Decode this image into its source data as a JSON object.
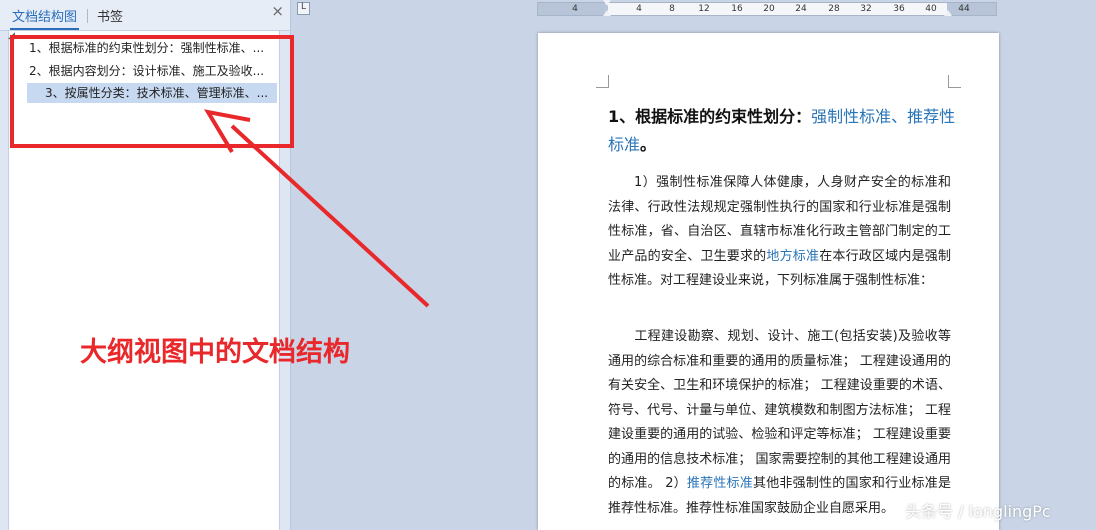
{
  "nav": {
    "tabs": [
      {
        "label": "文档结构图"
      },
      {
        "label": "书签"
      }
    ],
    "close_glyph": "×",
    "tree": [
      {
        "label": "1、根据标准的约束性划分：强制性标准、..."
      },
      {
        "label": "2、根据内容划分：设计标准、施工及验收..."
      },
      {
        "label": "3、按属性分类：技术标准、管理标准、..."
      }
    ]
  },
  "annotation": {
    "text": "大纲视图中的文档结构",
    "color": "#e8282a"
  },
  "ruler": {
    "corner_glyph": "L",
    "ticks": [
      "4",
      "4",
      "8",
      "12",
      "16",
      "20",
      "24",
      "28",
      "32",
      "36",
      "40",
      "44"
    ]
  },
  "document": {
    "heading": {
      "prefix": "1、根据标准的约束性划分：",
      "link1": "强制性标准",
      "sep": "、",
      "link2": "推荐性标准",
      "suffix": "。"
    },
    "para1": {
      "text_a": "1）强制性标准保障人体健康，人身财产安全的标准和法律、行政性法规规定强制性执行的国家和行业标准是强制性标准，省、自治区、直辖市标准化行政主管部门制定的工业产品的安全、卫生要求的",
      "link": "地方标准",
      "text_b": "在本行政区域内是强制性标准。对工程建设业来说，下列标准属于强制性标准："
    },
    "para2": {
      "text_a": "工程建设勘察、规划、设计、施工(包括安装)及验收等通用的综合标准和重要的通用的质量标准； 工程建设通用的有关安全、卫生和环境保护的标准； 工程建设重要的术语、符号、代号、计量与单位、建筑模数和制图方法标准； 工程建设重要的通用的试验、检验和评定等标准； 工程建设重要的通用的信息技术标准； 国家需要控制的其他工程建设通用的标准。 2）",
      "link": "推荐性标准",
      "text_b": "其他非强制性的国家和行业标准是推荐性标准。推荐性标准国家鼓励企业自愿采用。"
    },
    "link_color": "#2a74b8"
  },
  "watermark": "头条号 / longlingPc"
}
